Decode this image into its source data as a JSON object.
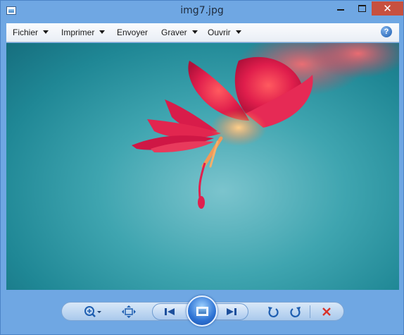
{
  "window": {
    "title": "img7.jpg",
    "close_glyph": "✕",
    "accent_color": "#6fa7e3",
    "close_color": "#c7503f"
  },
  "menu": {
    "items": [
      {
        "label": "Fichier",
        "has_dropdown": true
      },
      {
        "label": "Imprimer",
        "has_dropdown": true
      },
      {
        "label": "Envoyer",
        "has_dropdown": false
      },
      {
        "label": "Graver",
        "has_dropdown": true
      },
      {
        "label": "Ouvrir",
        "has_dropdown": true
      }
    ],
    "help_glyph": "?"
  },
  "image": {
    "subject": "red flower on teal background"
  },
  "toolbar": {
    "zoom_icon": "zoom-icon",
    "fit_icon": "actual-size-icon",
    "previous_icon": "previous-icon",
    "slideshow_icon": "slideshow-icon",
    "next_icon": "next-icon",
    "rotate_ccw_icon": "rotate-counterclockwise-icon",
    "rotate_cw_icon": "rotate-clockwise-icon",
    "delete_icon": "delete-icon",
    "delete_color": "#d8322a"
  }
}
